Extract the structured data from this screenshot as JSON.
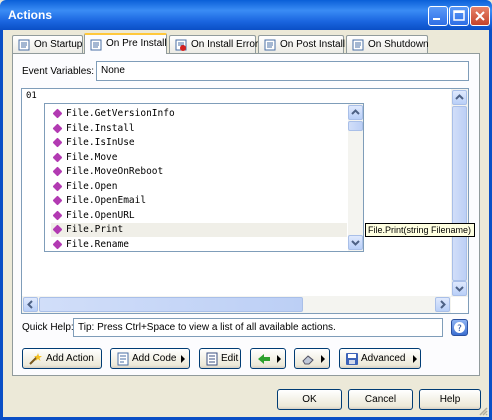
{
  "window": {
    "title": "Actions"
  },
  "tabs": [
    {
      "label": "On Startup",
      "icon": "page-icon"
    },
    {
      "label": "On Pre Install",
      "icon": "page-icon"
    },
    {
      "label": "On Install Error",
      "icon": "error-page-icon"
    },
    {
      "label": "On Post Install",
      "icon": "page-icon"
    },
    {
      "label": "On Shutdown",
      "icon": "page-icon"
    }
  ],
  "active_tab": "On Pre Install",
  "event_variables": {
    "label": "Event Variables:",
    "value": "None"
  },
  "editor": {
    "line_number": "01"
  },
  "autocomplete": {
    "items": [
      "File.GetVersionInfo",
      "File.Install",
      "File.IsInUse",
      "File.Move",
      "File.MoveOnReboot",
      "File.Open",
      "File.OpenEmail",
      "File.OpenURL",
      "File.Print",
      "File.Rename"
    ],
    "selected": "File.Print",
    "tooltip": "File.Print(string Filename)"
  },
  "quick_help": {
    "label": "Quick Help:",
    "value": "Tip: Press Ctrl+Space to view a list of all available actions."
  },
  "toolbar": {
    "add_action": "Add Action",
    "add_code": "Add Code",
    "edit": "Edit",
    "advanced": "Advanced"
  },
  "footer": {
    "ok": "OK",
    "cancel": "Cancel",
    "help": "Help"
  }
}
